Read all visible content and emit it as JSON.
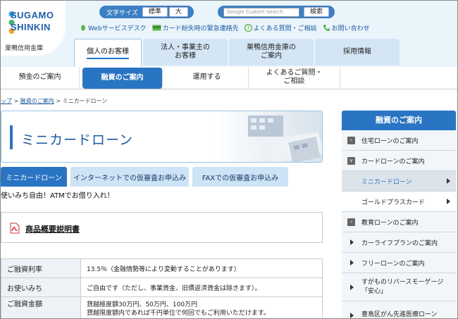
{
  "brand": {
    "line1": "SUGAMO",
    "line2": "SHINKIN",
    "subtitle": "巣鴨信用金庫"
  },
  "header": {
    "font_size_label": "文字サイズ",
    "font_size_standard": "標準",
    "font_size_large": "大",
    "search_placeholder": "Google Custom Search",
    "search_button": "検索"
  },
  "utility_links": [
    {
      "label": "Webサービスデスク",
      "icon": "mouse-icon"
    },
    {
      "label": "カード紛失時の緊急連絡先",
      "icon": "card-icon"
    },
    {
      "label": "よくある質問・ご相談",
      "icon": "question-icon"
    },
    {
      "label": "お問い合わせ",
      "icon": "phone-icon"
    }
  ],
  "nav_tabs": [
    {
      "label": "個人のお客様"
    },
    {
      "label": "法人・事業主の\nお客様"
    },
    {
      "label": "巣鴨信用金庫の\nご案内"
    },
    {
      "label": "採用情報"
    }
  ],
  "subnav": [
    {
      "label": "預金のご案内"
    },
    {
      "label": "融資のご案内"
    },
    {
      "label": "運用する"
    },
    {
      "label": "よくあるご質問・\nご相談"
    }
  ],
  "breadcrumb": {
    "home": "ップ",
    "loan": "融資のご案内",
    "current": "ミニカードローン",
    "sep": ">"
  },
  "page": {
    "title": "ミニカードローン",
    "tabs": [
      "ミニカードローン",
      "インターネットでの仮審査お申込み",
      "FAXでの仮審査お申込み"
    ],
    "tagline": "使いみち自由！ATMでお借り入れ！",
    "doc_link": "商品概要説明書"
  },
  "spec_rows": [
    {
      "label": "ご融資利率",
      "value": "13.5％（金融情勢等により変動することがあります）"
    },
    {
      "label": "お使いみち",
      "value": "ご自由です（ただし、事業資金、旧債返済資金は除きます）。"
    },
    {
      "label": "ご融資金額",
      "value": "貸越極度額30万円、50万円、100万円",
      "value2": "貸越限度額内であれば千円単位で何回でもご利用いただけます。"
    }
  ],
  "sidebar": {
    "title": "融資のご案内",
    "items": [
      {
        "label": "住宅ローンのご案内",
        "marker": "›"
      },
      {
        "label": "カードローンのご案内",
        "marker": "∨"
      },
      {
        "label": "ミニカードローン"
      },
      {
        "label": "ゴールドプラスカード"
      },
      {
        "label": "教育ローンのご案内",
        "marker": "›"
      },
      {
        "label": "カーライフプランのご案内"
      },
      {
        "label": "フリーローンのご案内"
      },
      {
        "label": "すがものリバースモーゲージ「安心」"
      },
      {
        "label": "豊島区がん先進医療ローン"
      }
    ]
  },
  "colors": {
    "accent": "#2a75c3",
    "nav_bg": "#d4e6f5",
    "header_bg": "#eaf4fb"
  }
}
